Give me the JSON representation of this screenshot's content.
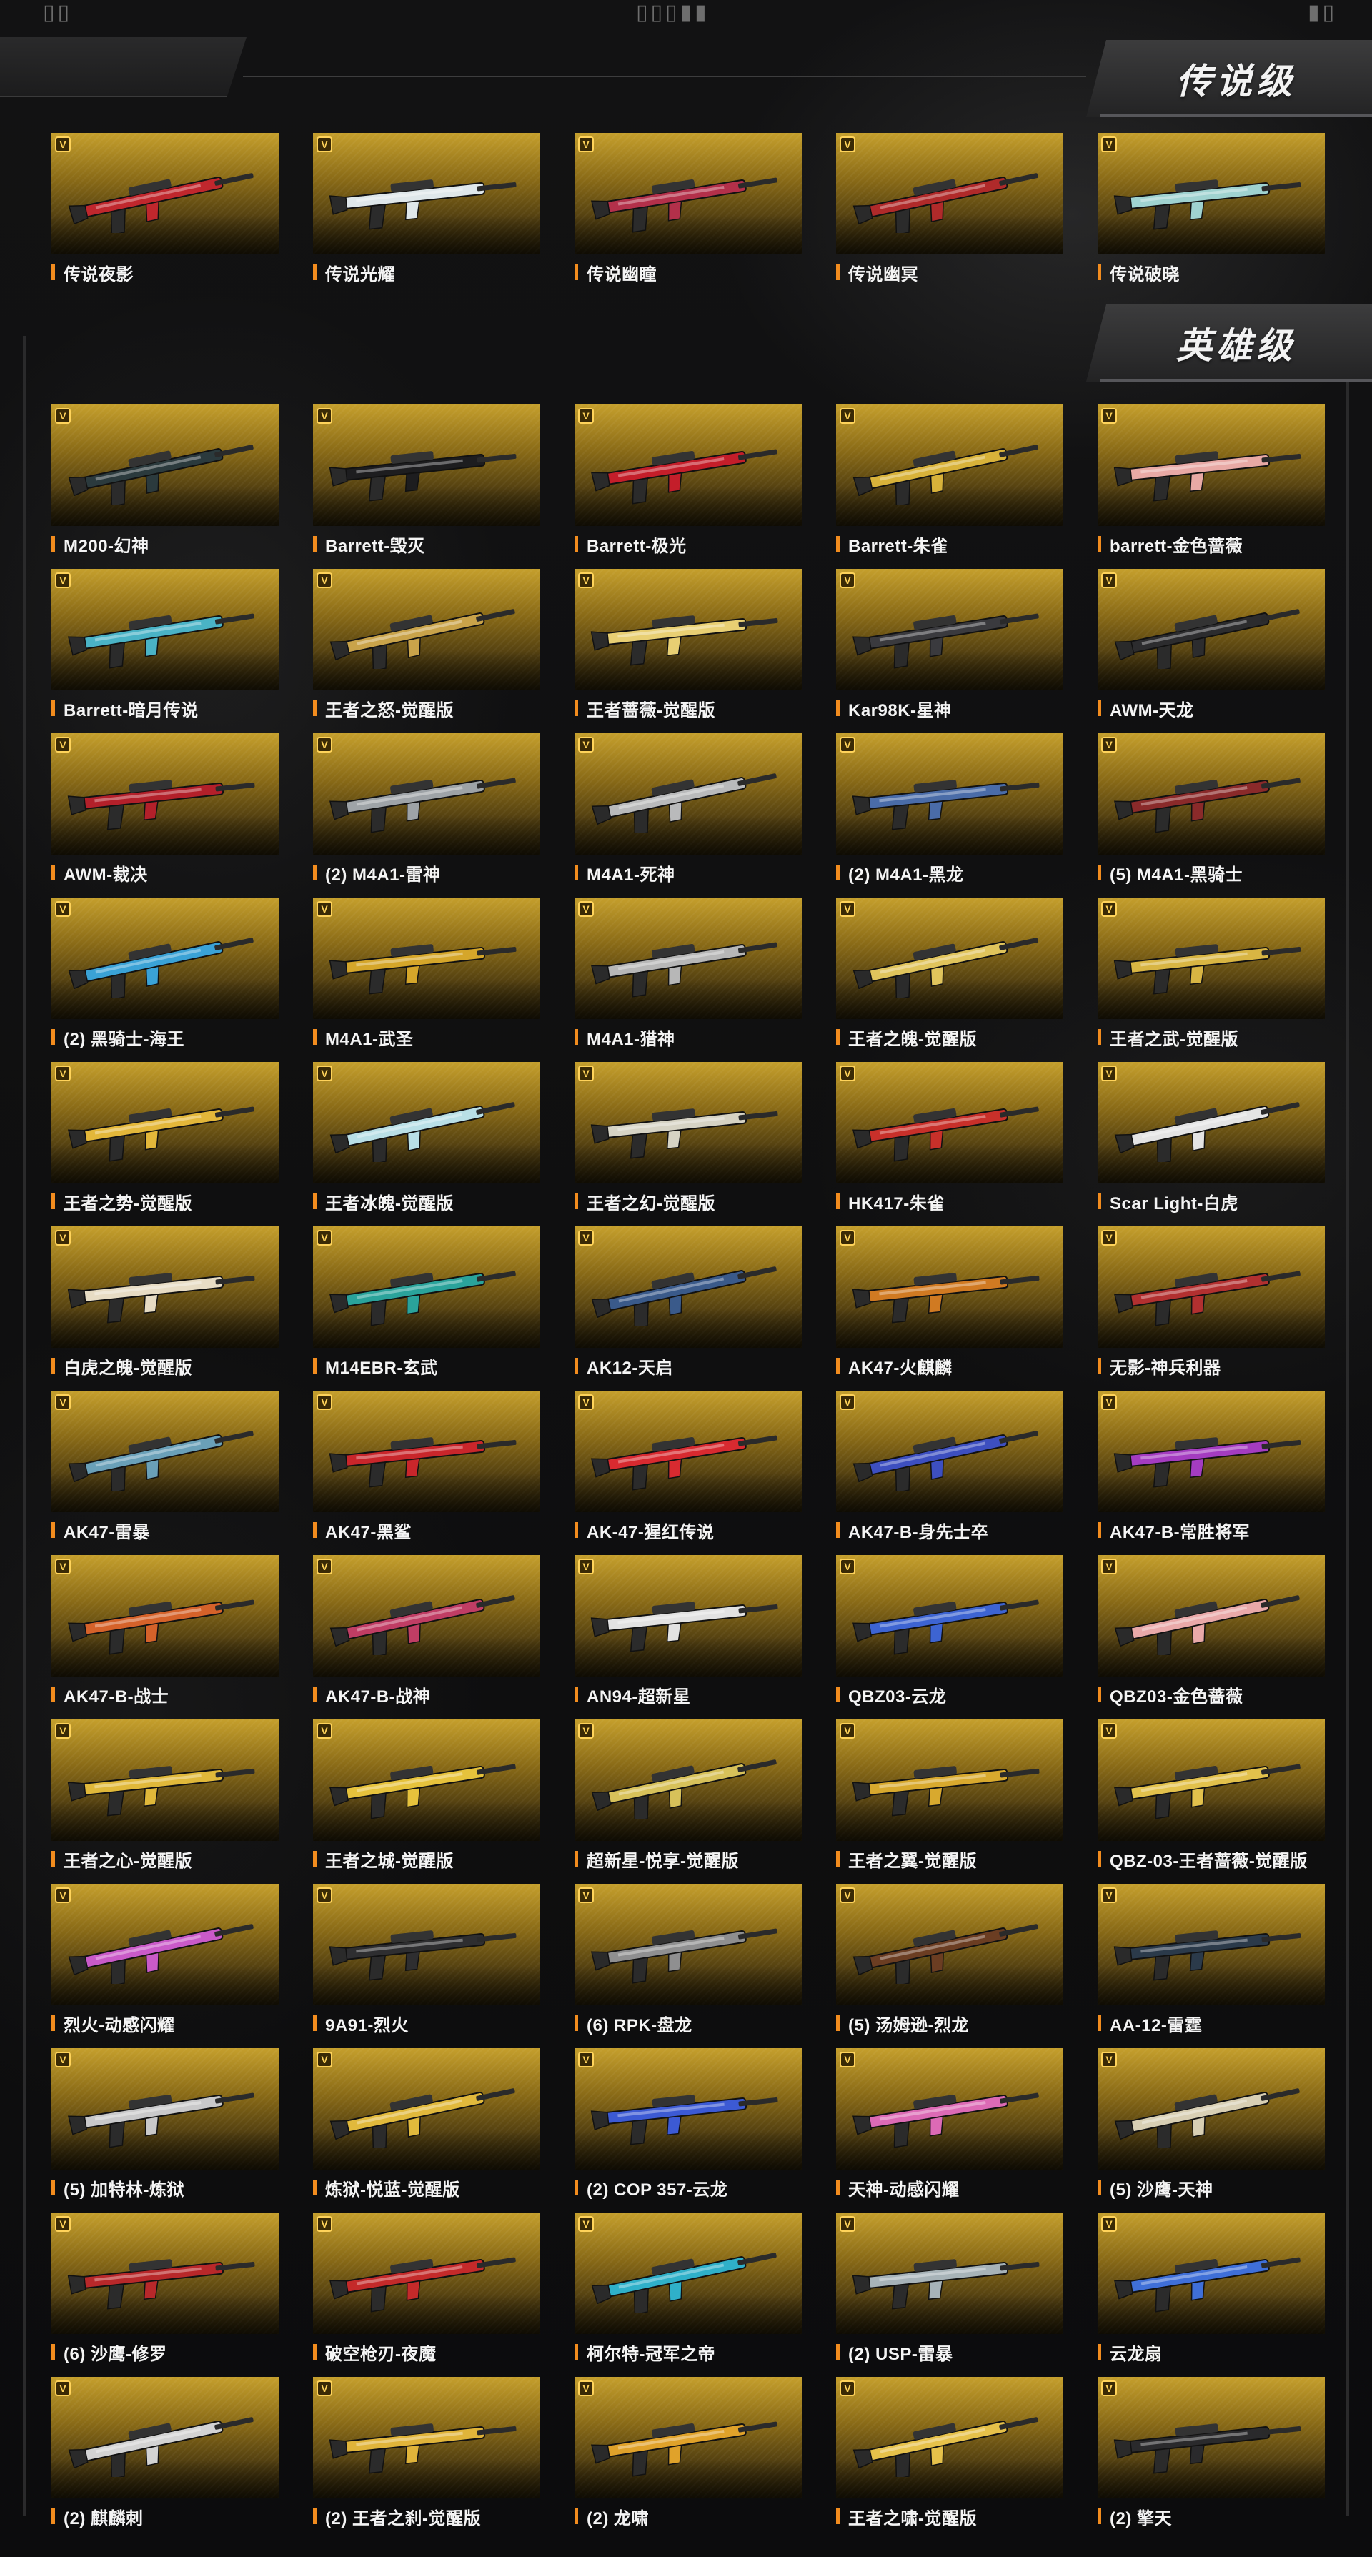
{
  "top_marks": {
    "left": "▯▯",
    "center": "▯▯▯▮▮",
    "right": "▮▯"
  },
  "sections": {
    "legendary": {
      "title": "传说级",
      "items": [
        {
          "label": "传说夜影",
          "accent": "#c0272d"
        },
        {
          "label": "传说光耀",
          "accent": "#dfe7ea"
        },
        {
          "label": "传说幽瞳",
          "accent": "#b3304a"
        },
        {
          "label": "传说幽冥",
          "accent": "#b02a2a"
        },
        {
          "label": "传说破晓",
          "accent": "#9fd2d0"
        }
      ]
    },
    "heroic": {
      "title": "英雄级",
      "items": [
        {
          "label": "M200-幻神",
          "accent": "#2b3a3d"
        },
        {
          "label": "Barrett-毁灭",
          "accent": "#1d1d1f"
        },
        {
          "label": "Barrett-极光",
          "accent": "#c41e2a"
        },
        {
          "label": "Barrett-朱雀",
          "accent": "#d8b23a"
        },
        {
          "label": "barrett-金色蔷薇",
          "accent": "#e8a9a5"
        },
        {
          "label": "Barrett-暗月传说",
          "accent": "#4ab3c6"
        },
        {
          "label": "王者之怒-觉醒版",
          "accent": "#c9a34a"
        },
        {
          "label": "王者蔷薇-觉醒版",
          "accent": "#e8cf73"
        },
        {
          "label": "Kar98K-星神",
          "accent": "#3a3a3e"
        },
        {
          "label": "AWM-天龙",
          "accent": "#2c2c2e"
        },
        {
          "label": "AWM-裁决",
          "accent": "#b3202a"
        },
        {
          "label": "(2) M4A1-雷神",
          "accent": "#9ea3a7"
        },
        {
          "label": "M4A1-死神",
          "accent": "#b9babb"
        },
        {
          "label": "(2) M4A1-黑龙",
          "accent": "#4a6ca8"
        },
        {
          "label": "(5) M4A1-黑骑士",
          "accent": "#8a2a2a"
        },
        {
          "label": "(2) 黑骑士-海王",
          "accent": "#3aa2d6"
        },
        {
          "label": "M4A1-武圣",
          "accent": "#d5a62a"
        },
        {
          "label": "M4A1-猎神",
          "accent": "#b7b7b7"
        },
        {
          "label": "王者之魄-觉醒版",
          "accent": "#e0c45c"
        },
        {
          "label": "王者之武-觉醒版",
          "accent": "#d8b543"
        },
        {
          "label": "王者之势-觉醒版",
          "accent": "#e3b73a"
        },
        {
          "label": "王者冰魄-觉醒版",
          "accent": "#b9dfe6"
        },
        {
          "label": "王者之幻-觉醒版",
          "accent": "#d6d3c4"
        },
        {
          "label": "HK417-朱雀",
          "accent": "#c8302a"
        },
        {
          "label": "Scar Light-白虎",
          "accent": "#e4e4e4"
        },
        {
          "label": "白虎之魄-觉醒版",
          "accent": "#e7dcc4"
        },
        {
          "label": "M14EBR-玄武",
          "accent": "#2aa39b"
        },
        {
          "label": "AK12-天启",
          "accent": "#3a5a8a"
        },
        {
          "label": "AK47-火麒麟",
          "accent": "#d07a22"
        },
        {
          "label": "无影-神兵利器",
          "accent": "#b23030"
        },
        {
          "label": "AK47-雷暴",
          "accent": "#6aa0b8"
        },
        {
          "label": "AK47-黑鲨",
          "accent": "#c9262b"
        },
        {
          "label": "AK-47-猩红传说",
          "accent": "#d82a30"
        },
        {
          "label": "AK47-B-身先士卒",
          "accent": "#3d4fc0"
        },
        {
          "label": "AK47-B-常胜将军",
          "accent": "#a43cc0"
        },
        {
          "label": "AK47-B-战士",
          "accent": "#d5622a"
        },
        {
          "label": "AK47-B-战神",
          "accent": "#c03d64"
        },
        {
          "label": "AN94-超新星",
          "accent": "#e2e2e2"
        },
        {
          "label": "QBZ03-云龙",
          "accent": "#3d64d2"
        },
        {
          "label": "QBZ03-金色蔷薇",
          "accent": "#e9a9a9"
        },
        {
          "label": "王者之心-觉醒版",
          "accent": "#e0b83a"
        },
        {
          "label": "王者之城-觉醒版",
          "accent": "#e6c23c"
        },
        {
          "label": "超新星-悦享-觉醒版",
          "accent": "#d7c15a"
        },
        {
          "label": "王者之翼-觉醒版",
          "accent": "#d8a92e"
        },
        {
          "label": "QBZ-03-王者蔷薇-觉醒版",
          "accent": "#e2c14c"
        },
        {
          "label": "烈火-动感闪耀",
          "accent": "#c95ac8"
        },
        {
          "label": "9A91-烈火",
          "accent": "#2e2e30"
        },
        {
          "label": "(6) RPK-盘龙",
          "accent": "#8f8f90"
        },
        {
          "label": "(5) 汤姆逊-烈龙",
          "accent": "#6b3d22"
        },
        {
          "label": "AA-12-雷霆",
          "accent": "#2b3a4a"
        },
        {
          "label": "(5) 加特林-炼狱",
          "accent": "#c9c9ca"
        },
        {
          "label": "炼狱-悦蓝-觉醒版",
          "accent": "#e1b93c"
        },
        {
          "label": "(2) COP 357-云龙",
          "accent": "#3c5ad4"
        },
        {
          "label": "天神-动感闪耀",
          "accent": "#dc6ab5"
        },
        {
          "label": "(5) 沙鹰-天神",
          "accent": "#d8cfb4"
        },
        {
          "label": "(6) 沙鹰-修罗",
          "accent": "#b8282a"
        },
        {
          "label": "破空枪刃-夜魔",
          "accent": "#c42a2a"
        },
        {
          "label": "柯尔特-冠军之帝",
          "accent": "#2fb0c9"
        },
        {
          "label": "(2) USP-雷暴",
          "accent": "#a7b3b8"
        },
        {
          "label": "云龙扇",
          "accent": "#3f6fd8"
        },
        {
          "label": "(2) 麒麟刺",
          "accent": "#d3d3d3"
        },
        {
          "label": "(2) 王者之刹-觉醒版",
          "accent": "#e0b43a"
        },
        {
          "label": "(2) 龙啸",
          "accent": "#e0a22a"
        },
        {
          "label": "王者之啸-觉醒版",
          "accent": "#e6c14a"
        },
        {
          "label": "(2) 擎天",
          "accent": "#2a2a2c"
        }
      ]
    }
  }
}
